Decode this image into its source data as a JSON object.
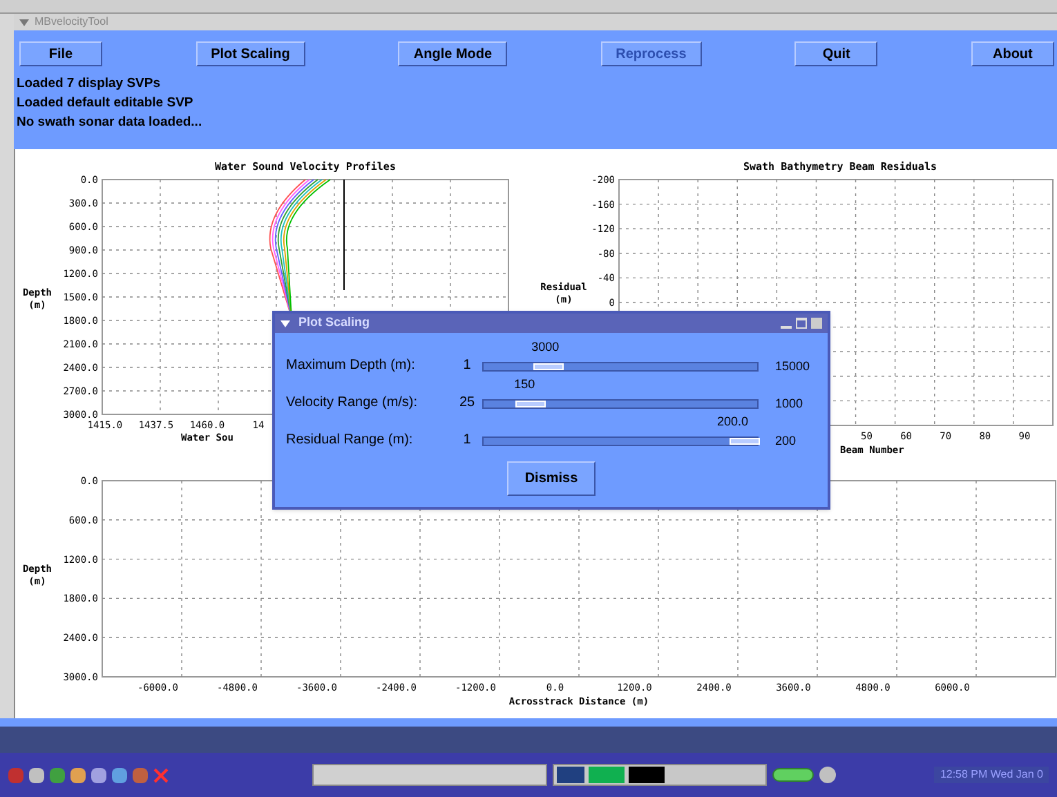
{
  "window": {
    "title": "MBvelocityTool"
  },
  "toolbar": [
    {
      "label": "File",
      "disabled": false
    },
    {
      "label": "Plot Scaling",
      "disabled": false
    },
    {
      "label": "Angle Mode",
      "disabled": false
    },
    {
      "label": "Reprocess",
      "disabled": true
    },
    {
      "label": "Quit",
      "disabled": false
    },
    {
      "label": "About",
      "disabled": false
    }
  ],
  "status_lines": [
    "Loaded 7 display SVPs",
    "Loaded default editable SVP",
    "No swath sonar data loaded..."
  ],
  "svp_plot": {
    "title": "Water Sound Velocity Profiles",
    "ylabel": [
      "Depth",
      "(m)"
    ],
    "xlabel": "Water Sou",
    "yticks": [
      "0.0",
      "300.0",
      "600.0",
      "900.0",
      "1200.0",
      "1500.0",
      "1800.0",
      "2100.0",
      "2400.0",
      "2700.0",
      "3000.0"
    ],
    "xticks": [
      "1415.0",
      "1437.5",
      "1460.0",
      "14"
    ]
  },
  "residual_plot": {
    "title": "Swath Bathymetry Beam Residuals",
    "ylabel": [
      "Residual",
      "(m)"
    ],
    "xlabel": "Beam Number",
    "yticks": [
      "-200",
      "-160",
      "-120",
      "-80",
      "-40",
      "0"
    ],
    "xticks": [
      "50",
      "60",
      "70",
      "80",
      "90"
    ]
  },
  "swath_plot": {
    "ylabel": [
      "Depth",
      "(m)"
    ],
    "xlabel": "Acrosstrack Distance (m)",
    "yticks": [
      "0.0",
      "600.0",
      "1200.0",
      "1800.0",
      "2400.0",
      "3000.0"
    ],
    "xticks": [
      "-6000.0",
      "-4800.0",
      "-3600.0",
      "-2400.0",
      "-1200.0",
      "0.0",
      "1200.0",
      "2400.0",
      "3600.0",
      "4800.0",
      "6000.0"
    ]
  },
  "dialog": {
    "title": "Plot Scaling",
    "sliders": [
      {
        "label": "Maximum Depth (m):",
        "min": "1",
        "value": "3000",
        "max": "15000",
        "level": 0.2
      },
      {
        "label": "Velocity Range (m/s):",
        "min": "25",
        "value": "150",
        "max": "1000",
        "level": 0.13
      },
      {
        "label": "Residual Range (m):",
        "min": "1",
        "value": "200.0",
        "max": "200",
        "level": 1
      }
    ],
    "button": "Dismiss"
  },
  "taskbar": {
    "clock": "12:58 PM Wed Jan 0"
  }
}
